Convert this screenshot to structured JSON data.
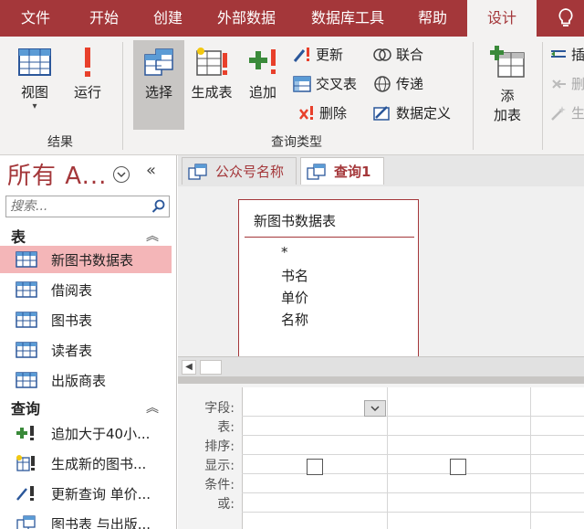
{
  "menu": {
    "items": [
      "文件",
      "开始",
      "创建",
      "外部数据",
      "数据库工具",
      "帮助",
      "设计"
    ],
    "active": "设计"
  },
  "ribbon": {
    "results_group": {
      "label": "结果",
      "view_label": "视图",
      "run_label": "运行"
    },
    "query_type_group": {
      "label": "查询类型",
      "select_label": "选择",
      "make_table_label": "生成表",
      "append_label": "追加",
      "update_label": "更新",
      "crosstab_label": "交叉表",
      "delete_label": "删除",
      "union_label": "联合",
      "passthrough_label": "传递",
      "data_definition_label": "数据定义"
    },
    "setup_group": {
      "add_table_label_1": "添",
      "add_table_label_2": "加表",
      "insert_label_partial": "插",
      "delete_partial": "删",
      "builder_partial": "生"
    }
  },
  "nav": {
    "title": "所有 A...",
    "search_placeholder": "搜索...",
    "tables_header": "表",
    "tables": [
      "新图书数据表",
      "借阅表",
      "图书表",
      "读者表",
      "出版商表"
    ],
    "selected_table": "新图书数据表",
    "queries_header": "查询",
    "queries": [
      "追加大于40小...",
      "生成新的图书...",
      "更新查询 单价...",
      "图书表 与出版..."
    ]
  },
  "doc": {
    "tabs": [
      "公众号名称",
      "查询1"
    ],
    "active_tab": "查询1",
    "table_box": {
      "title": "新图书数据表",
      "fields": [
        "*",
        "书名",
        "单价",
        "名称"
      ]
    },
    "grid_rows": [
      "字段:",
      "表:",
      "排序:",
      "显示:",
      "条件:",
      "或:"
    ]
  },
  "colors": {
    "accent": "#a4373a",
    "selected_row": "#f4b6b8",
    "ribbon_bg": "#f3f2f1"
  }
}
